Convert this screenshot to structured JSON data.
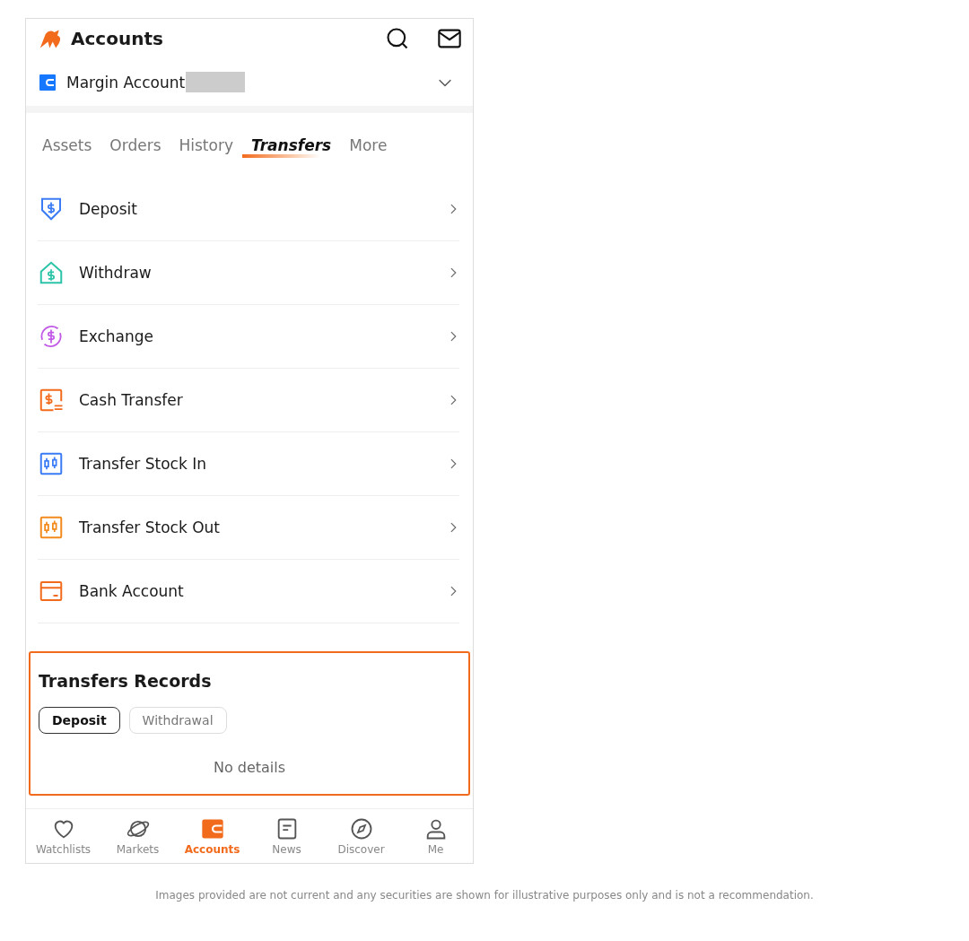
{
  "header": {
    "title": "Accounts"
  },
  "account": {
    "name": "Margin Account"
  },
  "tabs": [
    {
      "label": "Assets",
      "selected": false
    },
    {
      "label": "Orders",
      "selected": false
    },
    {
      "label": "History",
      "selected": false
    },
    {
      "label": "Transfers",
      "selected": true
    },
    {
      "label": "More",
      "selected": false
    }
  ],
  "menu": [
    {
      "kind": "deposit",
      "label": "Deposit"
    },
    {
      "kind": "withdraw",
      "label": "Withdraw"
    },
    {
      "kind": "exchange",
      "label": "Exchange"
    },
    {
      "kind": "cash",
      "label": "Cash Transfer"
    },
    {
      "kind": "stock-in",
      "label": "Transfer Stock In"
    },
    {
      "kind": "stock-out",
      "label": "Transfer Stock Out"
    },
    {
      "kind": "bank",
      "label": "Bank Account"
    }
  ],
  "records": {
    "title": "Transfers Records",
    "filters": [
      {
        "label": "Deposit",
        "selected": true
      },
      {
        "label": "Withdrawal",
        "selected": false
      }
    ],
    "empty": "No details"
  },
  "nav": [
    {
      "kind": "heart",
      "label": "Watchlists",
      "selected": false
    },
    {
      "kind": "planet",
      "label": "Markets",
      "selected": false
    },
    {
      "kind": "wallet",
      "label": "Accounts",
      "selected": true
    },
    {
      "kind": "news",
      "label": "News",
      "selected": false
    },
    {
      "kind": "compass",
      "label": "Discover",
      "selected": false
    },
    {
      "kind": "person",
      "label": "Me",
      "selected": false
    }
  ],
  "disclaimer": "Images provided are not current and any securities are shown for illustrative purposes only and is not a recommendation."
}
